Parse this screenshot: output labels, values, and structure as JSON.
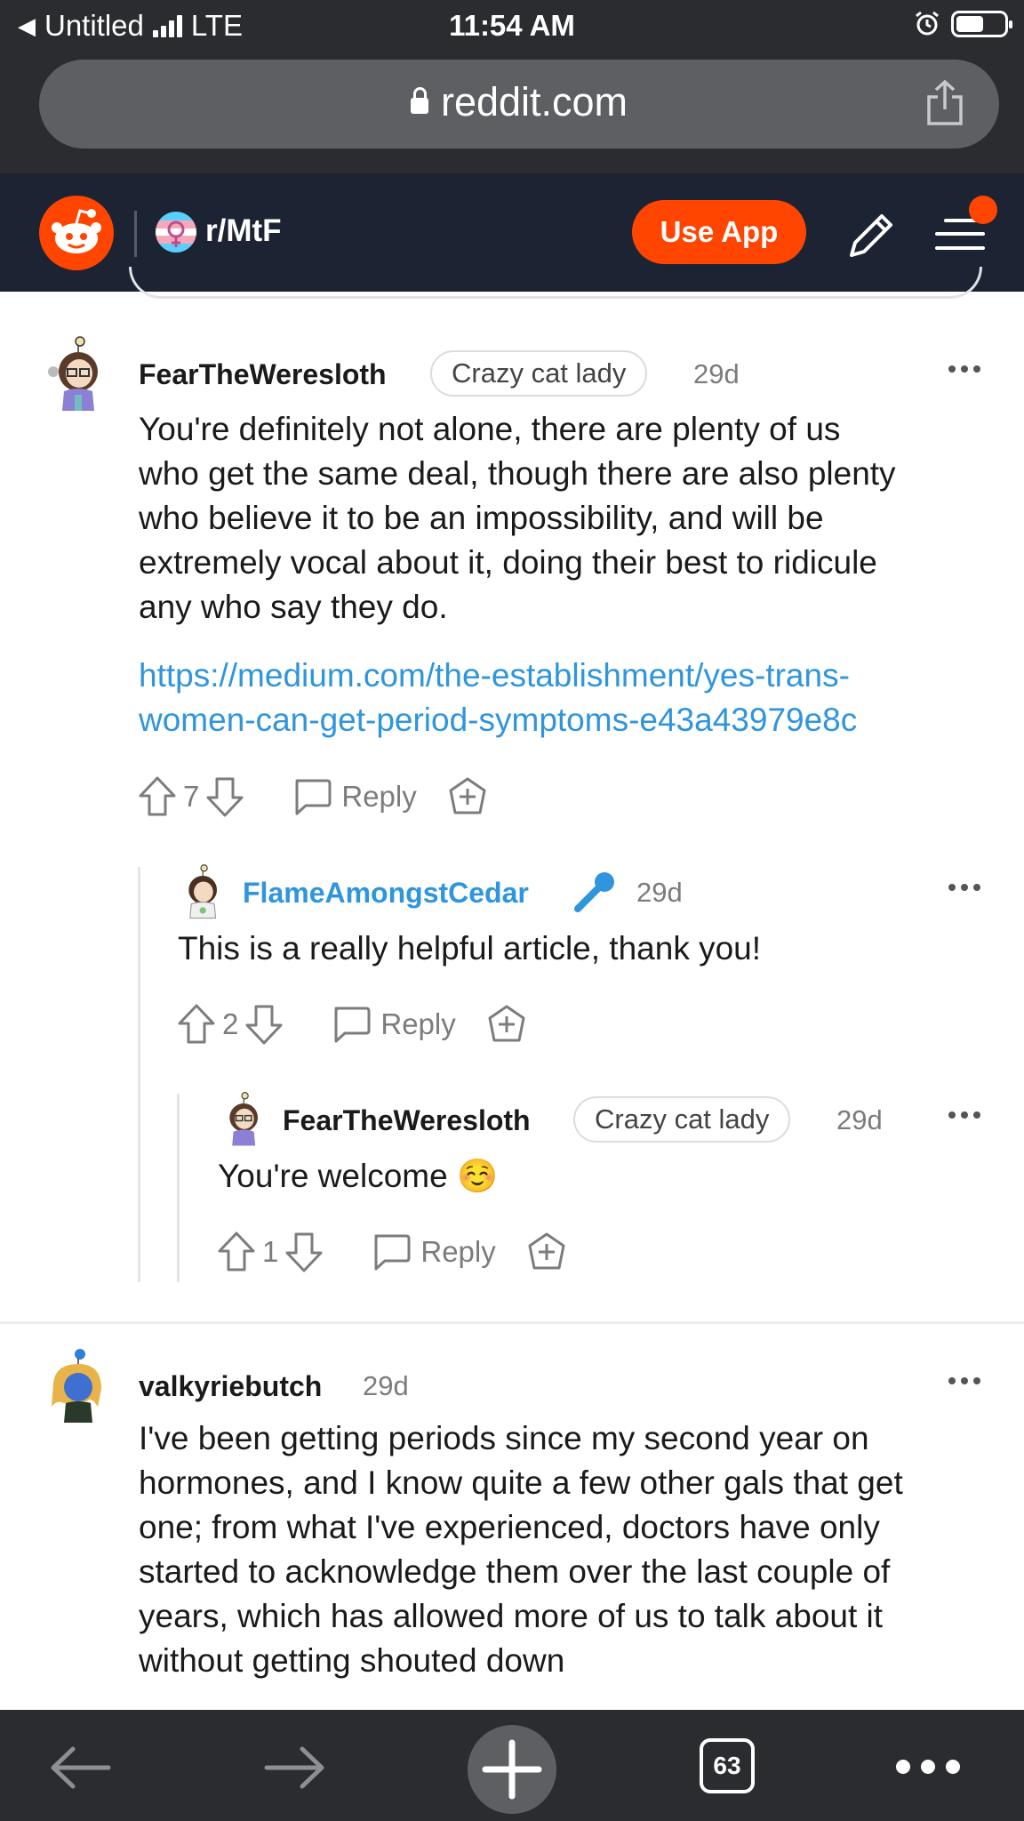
{
  "status_bar": {
    "back_app": "Untitled",
    "network": "LTE",
    "time": "11:54 AM"
  },
  "browser": {
    "url": "reddit.com"
  },
  "reddit_header": {
    "subreddit": "r/MtF",
    "use_app_label": "Use App",
    "brand_color": "#ff4500"
  },
  "comments": [
    {
      "username": "FearTheWeresloth",
      "flair": "Crazy cat lady",
      "age": "29d",
      "lines": [
        "You're definitely not alone, there are plenty of us",
        "who get the same deal, though there are also plenty",
        "who believe it to be an impossibility, and will be",
        "extremely vocal about it, doing their best to ridicule",
        "any who say they do."
      ],
      "link_lines": [
        "https://medium.com/the-establishment/yes-trans-",
        "women-can-get-period-symptoms-e43a43979e8c"
      ],
      "votes": "7",
      "reply_label": "Reply"
    },
    {
      "username": "FlameAmongstCedar",
      "age": "29d",
      "icon": "microphone-icon",
      "text": "This is a really helpful article, thank you!",
      "votes": "2",
      "reply_label": "Reply"
    },
    {
      "username": "FearTheWeresloth",
      "flair": "Crazy cat lady",
      "age": "29d",
      "text": "You're welcome ☺️",
      "votes": "1",
      "reply_label": "Reply"
    },
    {
      "username": "valkyriebutch",
      "age": "29d",
      "lines": [
        "I've been getting periods since my second year on",
        "hormones, and I know quite a few other gals that get",
        "one; from what I've experienced, doctors have only",
        "started to acknowledge them over the last couple of",
        "years, which has allowed more of us to talk about it",
        "without getting shouted down"
      ]
    }
  ],
  "bottom_bar": {
    "tab_count": "63"
  }
}
